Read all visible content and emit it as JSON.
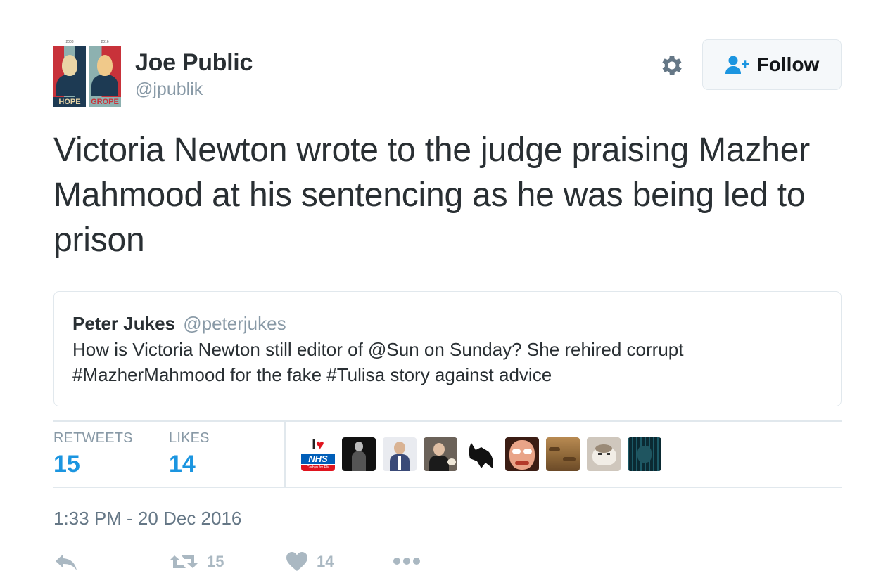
{
  "user": {
    "name": "Joe Public",
    "handle": "@jpublik",
    "avatar": {
      "left_year": "2008",
      "right_year": "2016",
      "left_word": "HOPE",
      "right_word": "GROPE"
    }
  },
  "header": {
    "settings_icon": "gear-icon",
    "follow_label": "Follow",
    "follow_icon": "person-add-icon"
  },
  "tweet": {
    "text": "Victoria Newton wrote to the judge praising Mazher Mahmood at his sentencing as he was being led to prison"
  },
  "quote": {
    "name": "Peter Jukes",
    "handle": "@peterjukes",
    "text": "How is Victoria Newton still editor of @Sun on Sunday? She rehired corrupt #MazherMahmood for the fake #Tulisa story against advice"
  },
  "stats": {
    "retweets_label": "RETWEETS",
    "retweets_count": "15",
    "likes_label": "LIKES",
    "likes_count": "14"
  },
  "likers": [
    {
      "name": "i-love-nhs-avatar",
      "line1": "I",
      "line2": "NHS",
      "caption": "Corbyn for PM"
    },
    {
      "name": "dark-silhouette-avatar"
    },
    {
      "name": "man-in-suit-avatar"
    },
    {
      "name": "man-at-dinner-avatar"
    },
    {
      "name": "bat-avatar"
    },
    {
      "name": "comic-face-avatar"
    },
    {
      "name": "desert-landscape-avatar"
    },
    {
      "name": "cat-avatar"
    },
    {
      "name": "tech-grid-avatar"
    }
  ],
  "timestamp": "1:33 PM - 20 Dec 2016",
  "actions": {
    "reply_icon": "reply-icon",
    "retweet_icon": "retweet-icon",
    "retweet_count": "15",
    "like_icon": "heart-icon",
    "like_count": "14",
    "more_icon": "more-icon"
  },
  "colors": {
    "accent": "#1b95e0",
    "muted": "#8899a6",
    "text": "#292f33",
    "border": "#e1e8ed",
    "icon": "#aab8c2"
  }
}
